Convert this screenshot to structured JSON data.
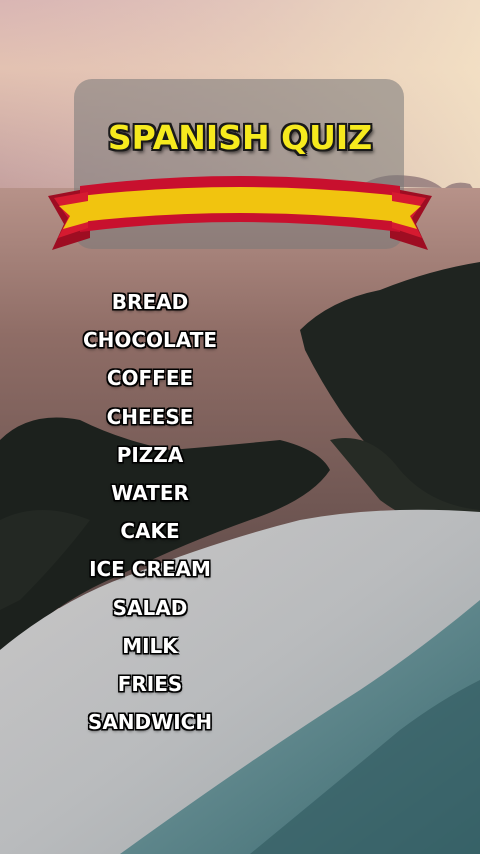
{
  "quiz": {
    "title": "SPANISH QUIZ",
    "flag_colors": {
      "red": "#c8102e",
      "yellow": "#f1c40f"
    },
    "words": [
      "BREAD",
      "CHOCOLATE",
      "COFFEE",
      "CHEESE",
      "PIZZA",
      "WATER",
      "CAKE",
      "ICE CREAM",
      "SALAD",
      "MILK",
      "FRIES",
      "SANDWICH"
    ]
  }
}
